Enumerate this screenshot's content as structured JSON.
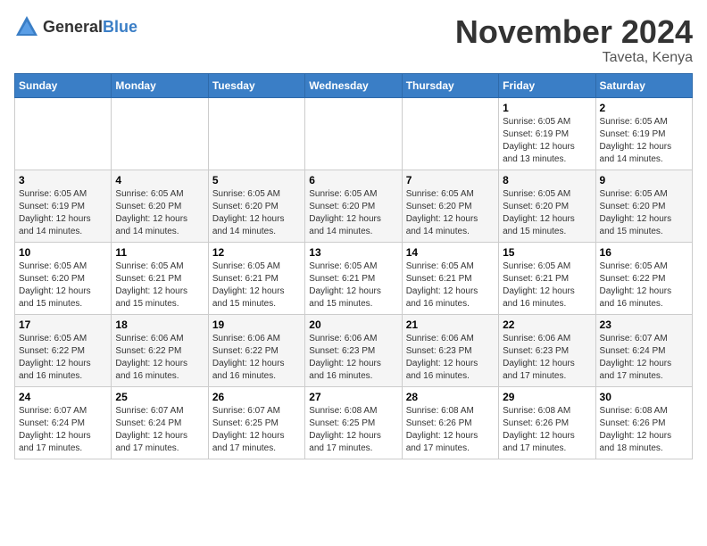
{
  "logo": {
    "text_general": "General",
    "text_blue": "Blue"
  },
  "title": {
    "month": "November 2024",
    "location": "Taveta, Kenya"
  },
  "weekdays": [
    "Sunday",
    "Monday",
    "Tuesday",
    "Wednesday",
    "Thursday",
    "Friday",
    "Saturday"
  ],
  "weeks": [
    [
      {
        "day": "",
        "sunrise": "",
        "sunset": "",
        "daylight": ""
      },
      {
        "day": "",
        "sunrise": "",
        "sunset": "",
        "daylight": ""
      },
      {
        "day": "",
        "sunrise": "",
        "sunset": "",
        "daylight": ""
      },
      {
        "day": "",
        "sunrise": "",
        "sunset": "",
        "daylight": ""
      },
      {
        "day": "",
        "sunrise": "",
        "sunset": "",
        "daylight": ""
      },
      {
        "day": "1",
        "sunrise": "Sunrise: 6:05 AM",
        "sunset": "Sunset: 6:19 PM",
        "daylight": "Daylight: 12 hours and 13 minutes."
      },
      {
        "day": "2",
        "sunrise": "Sunrise: 6:05 AM",
        "sunset": "Sunset: 6:19 PM",
        "daylight": "Daylight: 12 hours and 14 minutes."
      }
    ],
    [
      {
        "day": "3",
        "sunrise": "Sunrise: 6:05 AM",
        "sunset": "Sunset: 6:19 PM",
        "daylight": "Daylight: 12 hours and 14 minutes."
      },
      {
        "day": "4",
        "sunrise": "Sunrise: 6:05 AM",
        "sunset": "Sunset: 6:20 PM",
        "daylight": "Daylight: 12 hours and 14 minutes."
      },
      {
        "day": "5",
        "sunrise": "Sunrise: 6:05 AM",
        "sunset": "Sunset: 6:20 PM",
        "daylight": "Daylight: 12 hours and 14 minutes."
      },
      {
        "day": "6",
        "sunrise": "Sunrise: 6:05 AM",
        "sunset": "Sunset: 6:20 PM",
        "daylight": "Daylight: 12 hours and 14 minutes."
      },
      {
        "day": "7",
        "sunrise": "Sunrise: 6:05 AM",
        "sunset": "Sunset: 6:20 PM",
        "daylight": "Daylight: 12 hours and 14 minutes."
      },
      {
        "day": "8",
        "sunrise": "Sunrise: 6:05 AM",
        "sunset": "Sunset: 6:20 PM",
        "daylight": "Daylight: 12 hours and 15 minutes."
      },
      {
        "day": "9",
        "sunrise": "Sunrise: 6:05 AM",
        "sunset": "Sunset: 6:20 PM",
        "daylight": "Daylight: 12 hours and 15 minutes."
      }
    ],
    [
      {
        "day": "10",
        "sunrise": "Sunrise: 6:05 AM",
        "sunset": "Sunset: 6:20 PM",
        "daylight": "Daylight: 12 hours and 15 minutes."
      },
      {
        "day": "11",
        "sunrise": "Sunrise: 6:05 AM",
        "sunset": "Sunset: 6:21 PM",
        "daylight": "Daylight: 12 hours and 15 minutes."
      },
      {
        "day": "12",
        "sunrise": "Sunrise: 6:05 AM",
        "sunset": "Sunset: 6:21 PM",
        "daylight": "Daylight: 12 hours and 15 minutes."
      },
      {
        "day": "13",
        "sunrise": "Sunrise: 6:05 AM",
        "sunset": "Sunset: 6:21 PM",
        "daylight": "Daylight: 12 hours and 15 minutes."
      },
      {
        "day": "14",
        "sunrise": "Sunrise: 6:05 AM",
        "sunset": "Sunset: 6:21 PM",
        "daylight": "Daylight: 12 hours and 16 minutes."
      },
      {
        "day": "15",
        "sunrise": "Sunrise: 6:05 AM",
        "sunset": "Sunset: 6:21 PM",
        "daylight": "Daylight: 12 hours and 16 minutes."
      },
      {
        "day": "16",
        "sunrise": "Sunrise: 6:05 AM",
        "sunset": "Sunset: 6:22 PM",
        "daylight": "Daylight: 12 hours and 16 minutes."
      }
    ],
    [
      {
        "day": "17",
        "sunrise": "Sunrise: 6:05 AM",
        "sunset": "Sunset: 6:22 PM",
        "daylight": "Daylight: 12 hours and 16 minutes."
      },
      {
        "day": "18",
        "sunrise": "Sunrise: 6:06 AM",
        "sunset": "Sunset: 6:22 PM",
        "daylight": "Daylight: 12 hours and 16 minutes."
      },
      {
        "day": "19",
        "sunrise": "Sunrise: 6:06 AM",
        "sunset": "Sunset: 6:22 PM",
        "daylight": "Daylight: 12 hours and 16 minutes."
      },
      {
        "day": "20",
        "sunrise": "Sunrise: 6:06 AM",
        "sunset": "Sunset: 6:23 PM",
        "daylight": "Daylight: 12 hours and 16 minutes."
      },
      {
        "day": "21",
        "sunrise": "Sunrise: 6:06 AM",
        "sunset": "Sunset: 6:23 PM",
        "daylight": "Daylight: 12 hours and 16 minutes."
      },
      {
        "day": "22",
        "sunrise": "Sunrise: 6:06 AM",
        "sunset": "Sunset: 6:23 PM",
        "daylight": "Daylight: 12 hours and 17 minutes."
      },
      {
        "day": "23",
        "sunrise": "Sunrise: 6:07 AM",
        "sunset": "Sunset: 6:24 PM",
        "daylight": "Daylight: 12 hours and 17 minutes."
      }
    ],
    [
      {
        "day": "24",
        "sunrise": "Sunrise: 6:07 AM",
        "sunset": "Sunset: 6:24 PM",
        "daylight": "Daylight: 12 hours and 17 minutes."
      },
      {
        "day": "25",
        "sunrise": "Sunrise: 6:07 AM",
        "sunset": "Sunset: 6:24 PM",
        "daylight": "Daylight: 12 hours and 17 minutes."
      },
      {
        "day": "26",
        "sunrise": "Sunrise: 6:07 AM",
        "sunset": "Sunset: 6:25 PM",
        "daylight": "Daylight: 12 hours and 17 minutes."
      },
      {
        "day": "27",
        "sunrise": "Sunrise: 6:08 AM",
        "sunset": "Sunset: 6:25 PM",
        "daylight": "Daylight: 12 hours and 17 minutes."
      },
      {
        "day": "28",
        "sunrise": "Sunrise: 6:08 AM",
        "sunset": "Sunset: 6:26 PM",
        "daylight": "Daylight: 12 hours and 17 minutes."
      },
      {
        "day": "29",
        "sunrise": "Sunrise: 6:08 AM",
        "sunset": "Sunset: 6:26 PM",
        "daylight": "Daylight: 12 hours and 17 minutes."
      },
      {
        "day": "30",
        "sunrise": "Sunrise: 6:08 AM",
        "sunset": "Sunset: 6:26 PM",
        "daylight": "Daylight: 12 hours and 18 minutes."
      }
    ]
  ]
}
